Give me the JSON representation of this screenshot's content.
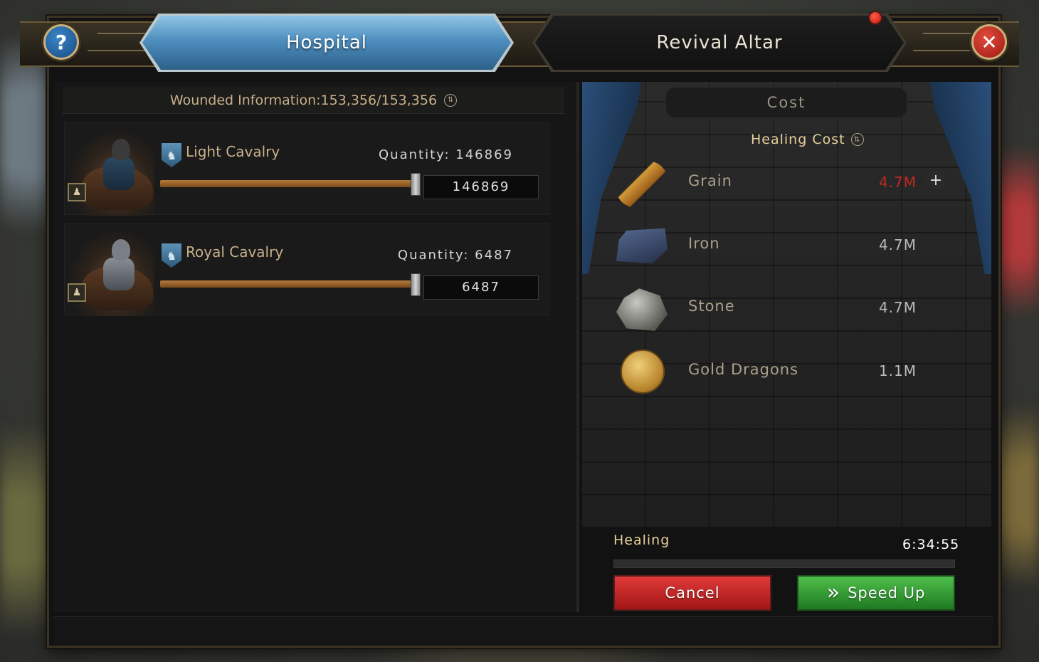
{
  "tabs": {
    "active": "Hospital",
    "items": [
      {
        "label": "Hospital"
      },
      {
        "label": "Revival Altar"
      }
    ]
  },
  "controls": {
    "help": "?",
    "close": "✕"
  },
  "wounded": {
    "label": "Wounded Information:153,356/153,356"
  },
  "troops": [
    {
      "name": "Light Cavalry",
      "quantity_label": "Quantity: 146869",
      "input_value": "146869",
      "selected_fraction": 1.0
    },
    {
      "name": "Royal Cavalry",
      "quantity_label": "Quantity: 6487",
      "input_value": "6487",
      "selected_fraction": 1.0
    }
  ],
  "cost": {
    "header": "Cost",
    "subheader": "Healing Cost",
    "resources": [
      {
        "name": "Grain",
        "value": "4.7M",
        "insufficient": true,
        "icon": "grain-icon"
      },
      {
        "name": "Iron",
        "value": "4.7M",
        "insufficient": false,
        "icon": "iron-icon"
      },
      {
        "name": "Stone",
        "value": "4.7M",
        "insufficient": false,
        "icon": "stone-icon"
      },
      {
        "name": "Gold Dragons",
        "value": "1.1M",
        "insufficient": false,
        "icon": "gold-dragon-icon"
      }
    ],
    "add_symbol": "+"
  },
  "healing": {
    "label": "Healing",
    "time": "6:34:55",
    "progress_fraction": 0.0
  },
  "buttons": {
    "cancel": "Cancel",
    "speed_up": "Speed Up",
    "speed_up_icon": "»"
  },
  "colors": {
    "accent_gold": "#e6cf9a",
    "insufficient_red": "#c02a22",
    "tab_active_blue": "#4f8fbf",
    "cancel_red": "#c52525",
    "speedup_green": "#2f9a33"
  }
}
